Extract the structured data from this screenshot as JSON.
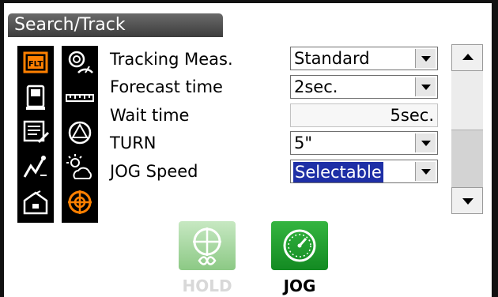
{
  "title": "Search/Track",
  "rows": [
    {
      "label": "Tracking Meas.",
      "value": "Standard"
    },
    {
      "label": "Forecast time",
      "value": "2sec."
    },
    {
      "label": "Wait time",
      "value": "5sec."
    },
    {
      "label": "TURN",
      "value": "5\""
    },
    {
      "label": "JOG Speed",
      "value": "Selectable"
    }
  ],
  "function_keys": {
    "hold_label": "HOLD",
    "jog_label": "JOG"
  },
  "tab_icons_left": [
    "tracking-flt-icon",
    "instrument-icon",
    "notepad-icon",
    "graph-icon",
    "toolbox-icon"
  ],
  "tab_icons_right": [
    "target-prism-icon",
    "ruler-icon",
    "prism-face-icon",
    "weather-icon",
    "search-target-icon"
  ],
  "colors": {
    "accent_orange": "#ff8000",
    "selection_blue": "#1e2fa6",
    "hold_green": "#9fd39a",
    "jog_green": "#1f9e2c"
  }
}
